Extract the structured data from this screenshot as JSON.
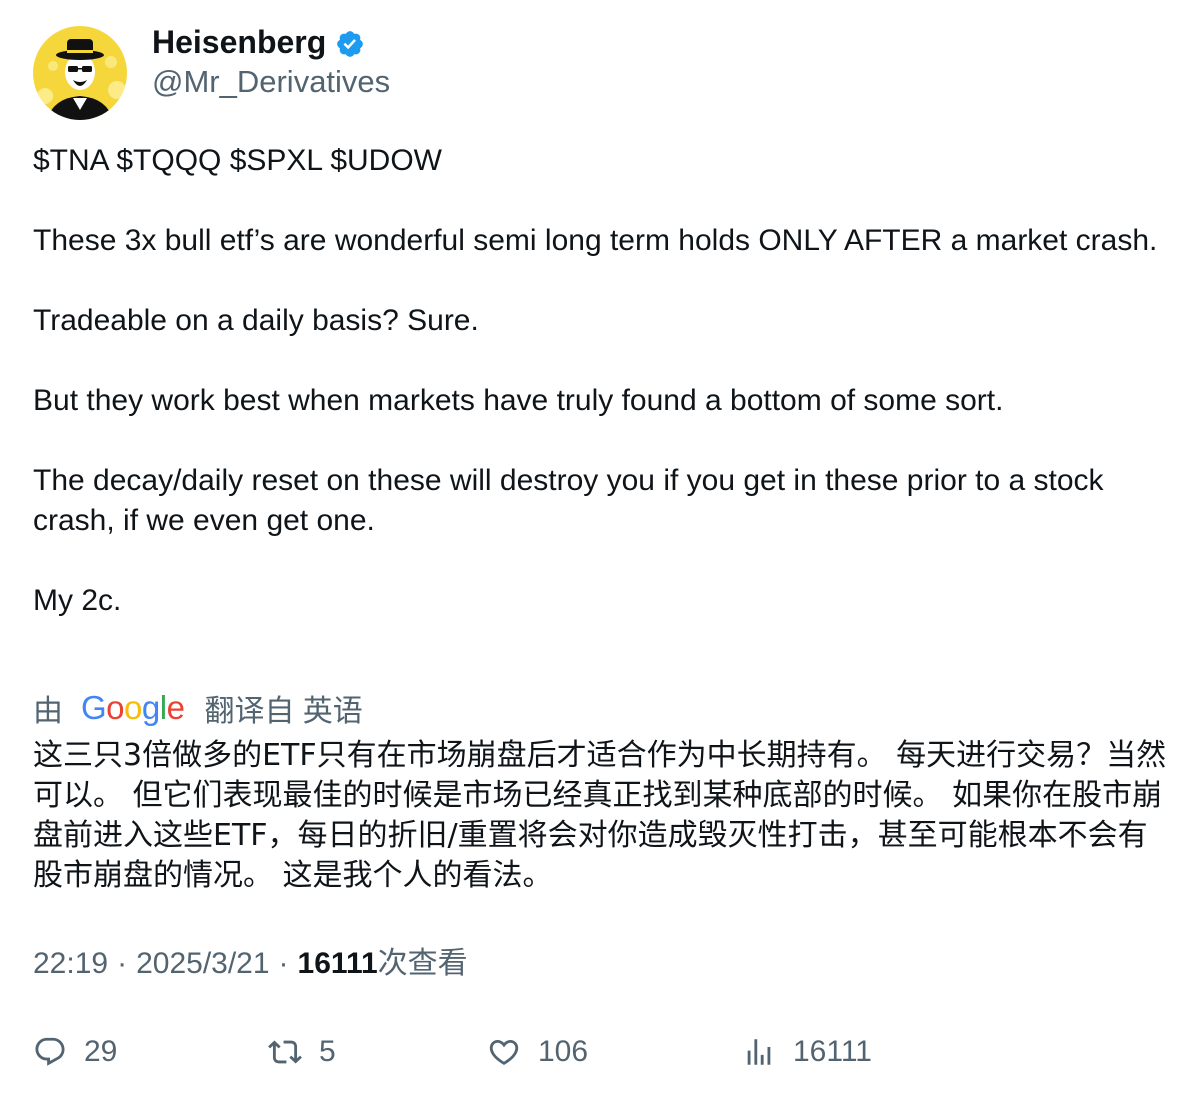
{
  "author": {
    "display_name": "Heisenberg",
    "handle": "@Mr_Derivatives",
    "verified": true
  },
  "tweet": {
    "paragraphs": [
      "$TNA $TQQQ $SPXL $UDOW",
      "These 3x bull etf’s are wonderful semi long term holds ONLY AFTER a market crash.",
      "Tradeable on a daily basis? Sure.",
      "But they work best when markets have truly found a bottom of some sort.",
      "The decay/daily reset on these will destroy you if you get in these prior to a stock crash, if we even get one.",
      "My 2c."
    ]
  },
  "translation": {
    "by_label": "由",
    "provider_letters": [
      "G",
      "o",
      "o",
      "g",
      "l",
      "e"
    ],
    "translated_from_label": "翻译自 英语",
    "text": "这三只3倍做多的ETF只有在市场崩盘后才适合作为中长期持有。 每天进行交易？当然可以。 但它们表现最佳的时候是市场已经真正找到某种底部的时候。 如果你在股市崩盘前进入这些ETF，每日的折旧/重置将会对你造成毁灭性打击，甚至可能根本不会有股市崩盘的情况。 这是我个人的看法。"
  },
  "meta": {
    "time": "22:19",
    "separator": "·",
    "date": "2025/3/21",
    "views_count": "16111",
    "views_label": "次查看"
  },
  "actions": {
    "replies": "29",
    "retweets": "5",
    "likes": "106",
    "views": "16111"
  },
  "colors": {
    "text_primary": "#0f1419",
    "text_secondary": "#536471",
    "verified_blue": "#1d9bf0",
    "avatar_yellow": "#f5d63b"
  },
  "icons": [
    "verified-badge-icon",
    "reply-icon",
    "retweet-icon",
    "like-icon",
    "views-icon"
  ]
}
